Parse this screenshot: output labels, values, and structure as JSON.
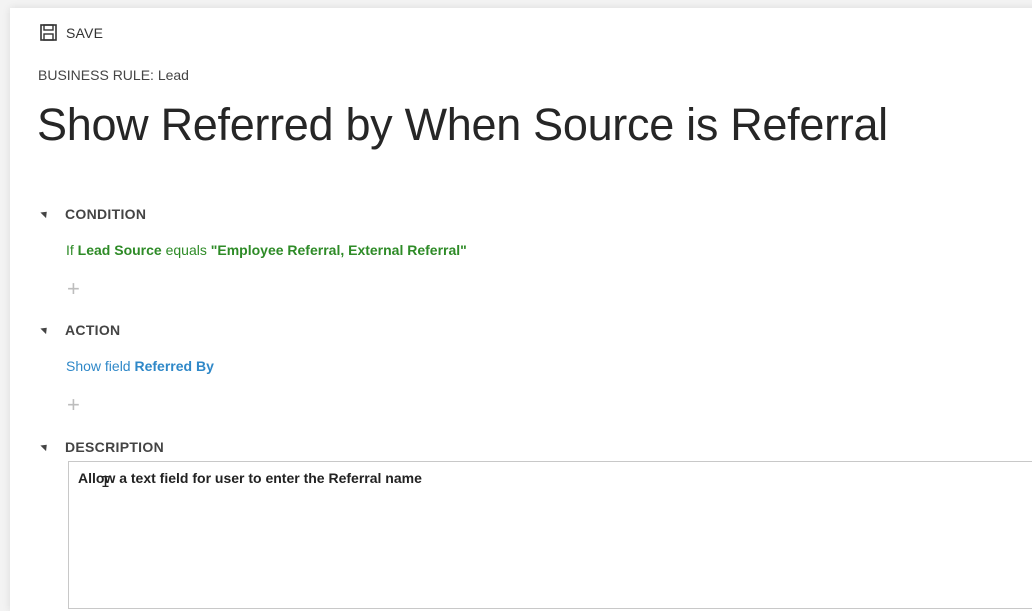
{
  "toolbar": {
    "save_label": "SAVE",
    "save_icon": "save-disk-icon"
  },
  "header": {
    "entity_prefix": "BUSINESS RULE:",
    "entity_name": "Lead",
    "title": "Show Referred by When Source is Referral"
  },
  "sections": {
    "condition": {
      "heading": "CONDITION",
      "clause_prefix": "If",
      "field": "Lead Source",
      "operator": "equals",
      "value": "\"Employee Referral, External Referral\""
    },
    "action": {
      "heading": "ACTION",
      "clause_prefix": "Show field",
      "field": "Referred By"
    },
    "description": {
      "heading": "DESCRIPTION",
      "text": "Allow a text field for user to enter the Referral name"
    }
  },
  "add_icon": "plus-icon",
  "colors": {
    "condition_green": "#2e8b27",
    "action_blue": "#2f88c8",
    "add_plus_gray": "#bdbdbd"
  }
}
